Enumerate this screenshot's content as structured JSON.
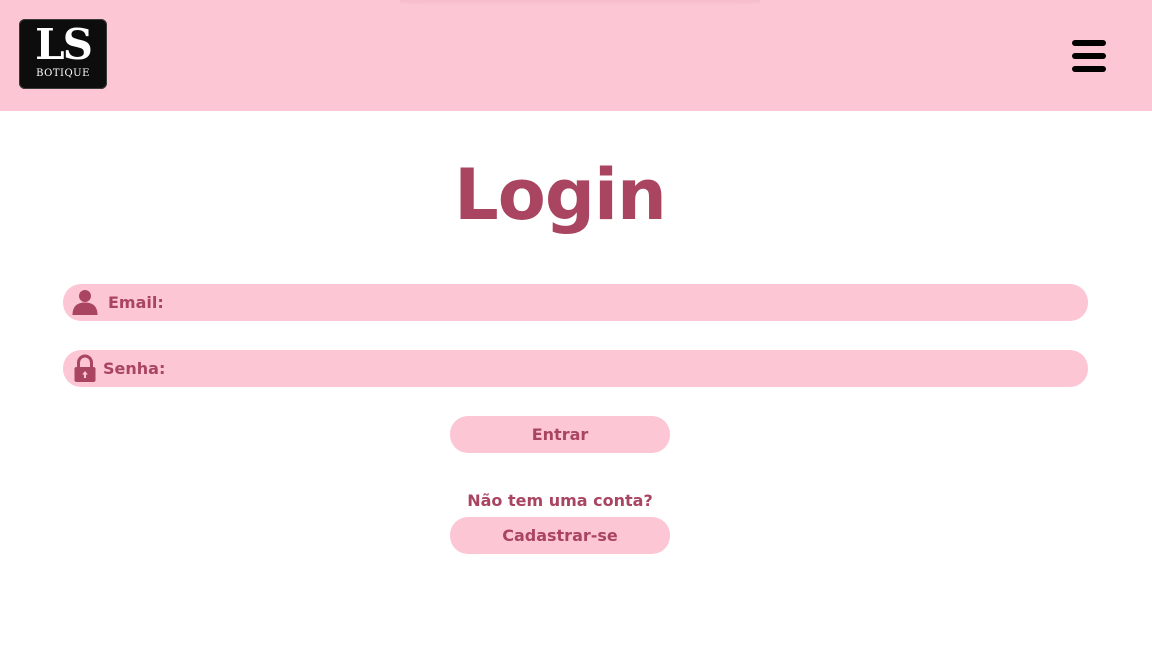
{
  "header": {
    "logo": {
      "main": "LS",
      "sub": "BOTIQUE"
    },
    "menu_icon": "hamburger-menu-icon",
    "background": "#fcc6d5"
  },
  "main": {
    "title": "Login",
    "email": {
      "label": "Email:",
      "value": "",
      "icon": "user-icon"
    },
    "password": {
      "label": "Senha:",
      "value": "",
      "icon": "lock-icon"
    },
    "submit_label": "Entrar",
    "signup_prompt": "Não tem uma conta?",
    "signup_label": "Cadastrar-se"
  },
  "colors": {
    "accent": "#a94560",
    "pink": "#fcc6d5",
    "logo_bg": "#0d0d0d"
  }
}
